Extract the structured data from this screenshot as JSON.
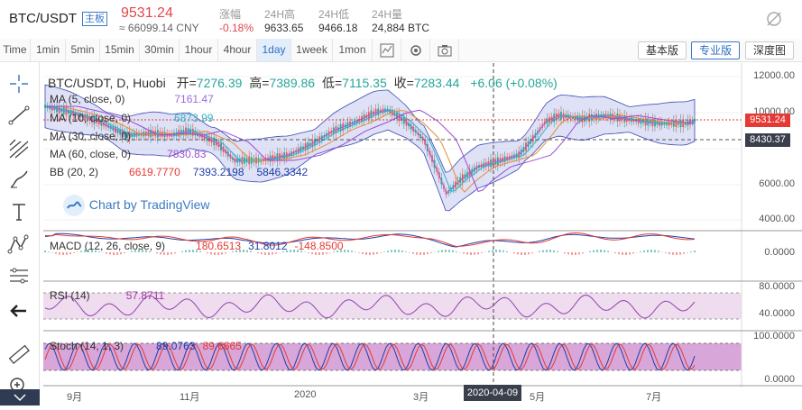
{
  "header": {
    "symbol": "BTC/USDT",
    "badge": "主板",
    "last_price": "9531.24",
    "cny_price": "≈ 66099.14 CNY",
    "stats": [
      {
        "label": "涨幅",
        "value": "-0.18%"
      },
      {
        "label": "24H高",
        "value": "9633.65"
      },
      {
        "label": "24H低",
        "value": "9466.18"
      },
      {
        "label": "24H量",
        "value": "24,884 BTC"
      }
    ]
  },
  "toolbar": {
    "intervals": [
      "Time",
      "1min",
      "5min",
      "15min",
      "30min",
      "1hour",
      "4hour",
      "1day",
      "1week",
      "1mon"
    ],
    "active_interval": "1day",
    "buttons": [
      "基本版",
      "专业版",
      "深度图"
    ],
    "selected_button": "专业版"
  },
  "chart": {
    "title": "BTC/USDT, D, Huobi",
    "ohlc": {
      "open_label": "开=",
      "open": "7276.39",
      "high_label": "高=",
      "high": "7389.86",
      "low_label": "低=",
      "low": "7115.35",
      "close_label": "收=",
      "close": "7283.44",
      "change": "+6.06 (+0.08%)"
    },
    "indicators": [
      {
        "label": "MA (5, close, 0)",
        "value": "7161.47",
        "color": "#9c6ade"
      },
      {
        "label": "MA (10, close, 0)",
        "value": "6873.99",
        "color": "#2bb5c9"
      },
      {
        "label": "MA (30, close, 0)",
        "value": "",
        "color": "#e28f3b"
      },
      {
        "label": "MA (60, close, 0)",
        "value": "7830.83",
        "color": "#9b4fd1"
      },
      {
        "label": "BB (20, 2)",
        "values": [
          "6619.7770",
          "7393.2198",
          "5846.3342"
        ],
        "colors": [
          "#e53935",
          "#1e3fa8",
          "#1e3fa8"
        ]
      }
    ],
    "watermark": "Chart by TradingView",
    "price_axis": [
      "12000.00",
      "10000.00",
      "6000.00",
      "4000.00"
    ],
    "last_price_tag": "9531.24",
    "level_tag": "8430.37",
    "macd": {
      "label": "MACD (12, 26, close, 9)",
      "values": [
        "180.6513",
        "31.8012",
        "-148.8500"
      ],
      "axis": "0.0000"
    },
    "rsi": {
      "label": "RSI (14)",
      "value": "57.8711",
      "axis": [
        "80.0000",
        "40.0000"
      ]
    },
    "stoch": {
      "label": "Stoch (14, 1, 3)",
      "values": [
        "89.0763",
        "89.6665"
      ],
      "axis": [
        "100.0000",
        "0.0000"
      ]
    },
    "time_axis": [
      "9月",
      "11月",
      "2020",
      "3月",
      "5月",
      "7月"
    ],
    "crosshair_date": "2020-04-09",
    "colors": {
      "up": "#26a69a",
      "down": "#ef5350",
      "bb_fill": "#c5c9ef",
      "rsi_fill": "#f0dcef",
      "stoch_fill": "#d8a6d8"
    }
  },
  "sidebar_tools": [
    "crosshair-icon",
    "trend-line-icon",
    "pitchfork-icon",
    "brush-icon",
    "text-icon",
    "pattern-icon",
    "measure-icon",
    "back-arrow-icon",
    "ruler-icon",
    "zoom-in-icon"
  ]
}
